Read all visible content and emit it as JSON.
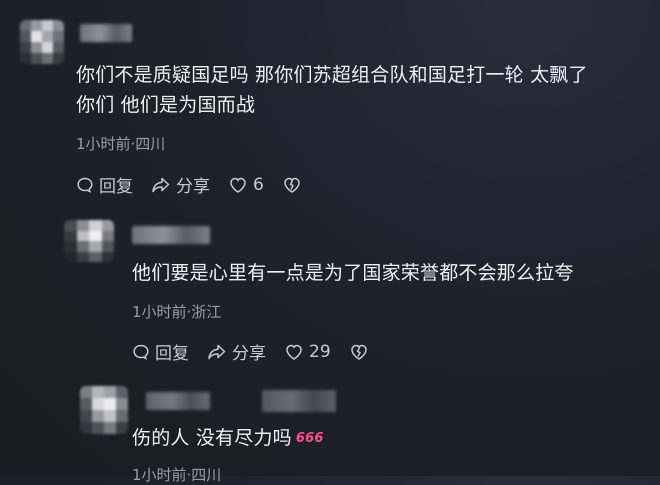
{
  "comments": [
    {
      "text_line1": "你们不是质疑国足吗  那你们苏超组合队和国足打一轮  太飘了",
      "text_line2": "你们  他们是为国而战",
      "meta": "1小时前·四川",
      "reply_label": "回复",
      "share_label": "分享",
      "likes": "6"
    },
    {
      "text": "他们要是心里有一点是为了国家荣誉都不会那么拉夸",
      "meta": "1小时前·浙江",
      "reply_label": "回复",
      "share_label": "分享",
      "likes": "29"
    },
    {
      "text": "伤的人  没有尽力吗",
      "emoji": "666",
      "meta": "1小时前·四川"
    }
  ],
  "colors": {
    "background": "#1f212b",
    "text": "#f0f0f3",
    "meta": "#9a9ba3",
    "emoji": "#ff4d8a"
  },
  "icons": [
    "reply-icon",
    "share-icon",
    "like-heart-icon",
    "dislike-heart-icon"
  ]
}
